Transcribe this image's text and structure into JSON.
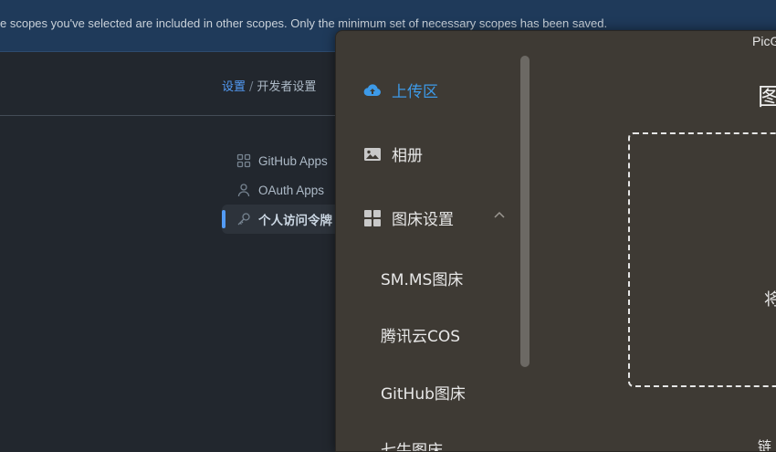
{
  "flash": {
    "text": "e scopes you've selected are included in other scopes. Only the minimum set of necessary scopes has been saved."
  },
  "breadcrumb": {
    "parent": "设置",
    "separator": "/",
    "current": "开发者设置"
  },
  "side_nav": {
    "items": [
      {
        "label": "GitHub Apps",
        "icon": "apps-grid-icon"
      },
      {
        "label": "OAuth Apps",
        "icon": "person-icon"
      },
      {
        "label": "个人访问令牌",
        "icon": "key-icon"
      }
    ],
    "active_index": 2
  },
  "picgo": {
    "title": "PicG",
    "menu": {
      "upload": "上传区",
      "album": "相册",
      "bed_settings": "图床设置"
    },
    "submenu": [
      "SM.MS图床",
      "腾讯云COS",
      "GitHub图床",
      "七牛图床"
    ],
    "heading": "图",
    "drop_text": "将",
    "bottom_text": "链"
  },
  "colors": {
    "accent": "#3d9ae8",
    "github_link": "#539bf5",
    "picgo_bg": "#3e3a34"
  }
}
